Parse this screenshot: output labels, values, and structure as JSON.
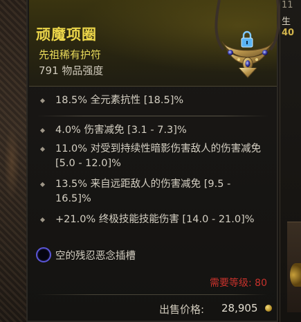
{
  "tooltip": {
    "item_name": "顽魔项圈",
    "item_type": "先祖稀有护符",
    "item_power": "791 物品强度",
    "colors": {
      "name": "#ecd64a",
      "type": "#e7d95a",
      "requirement": "#c8322c",
      "socket_ring": "#5a55d6"
    },
    "implicit": [
      {
        "text": "18.5% 全元素抗性 [18.5]%"
      }
    ],
    "affixes": [
      {
        "text": "4.0% 伤害减免 [3.1 - 7.3]%"
      },
      {
        "text": "11.0% 对受到持续性暗影伤害敌人的伤害减免 [5.0 - 12.0]%"
      },
      {
        "text": "13.5% 来自远距敌人的伤害减免 [9.5 - 16.5]%"
      },
      {
        "text": "+21.0% 终极技能技能伤害 [14.0 - 21.0]%"
      }
    ],
    "socket": {
      "text": "空的残忍恶念插槽",
      "icon": "empty-socket-icon"
    },
    "requirement": "需要等级: 80",
    "sell_label": "出售价格:",
    "sell_value": "28,905",
    "currency_icon": "gold-coin-icon",
    "amulet_icon": "amulet-icon",
    "lock_icon": "lock-icon"
  },
  "side_panel": {
    "top_text": "11",
    "mid_text": "生",
    "number_text": "40"
  }
}
